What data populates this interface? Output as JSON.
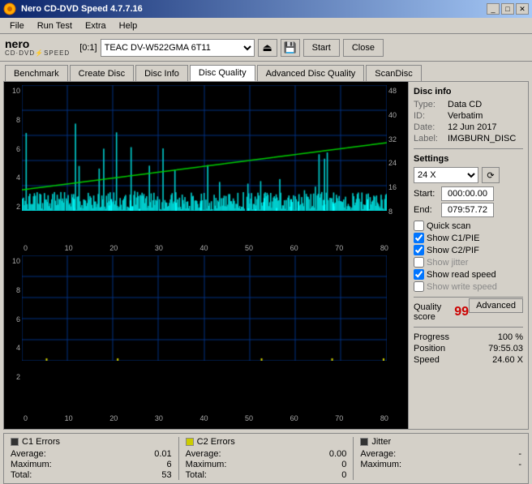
{
  "window": {
    "title": "Nero CD-DVD Speed 4.7.7.16",
    "title_buttons": [
      "_",
      "□",
      "✕"
    ]
  },
  "menu": {
    "items": [
      "File",
      "Run Test",
      "Extra",
      "Help"
    ]
  },
  "toolbar": {
    "drive_label": "[0:1]",
    "drive_value": "TEAC DV-W522GMA 6T11",
    "start_label": "Start",
    "close_label": "Close"
  },
  "tabs": [
    {
      "id": "benchmark",
      "label": "Benchmark"
    },
    {
      "id": "create-disc",
      "label": "Create Disc"
    },
    {
      "id": "disc-info",
      "label": "Disc Info"
    },
    {
      "id": "disc-quality",
      "label": "Disc Quality",
      "active": true
    },
    {
      "id": "advanced-disc-quality",
      "label": "Advanced Disc Quality"
    },
    {
      "id": "scandisc",
      "label": "ScanDisc"
    }
  ],
  "disc_info": {
    "section": "Disc info",
    "type_label": "Type:",
    "type_value": "Data CD",
    "id_label": "ID:",
    "id_value": "Verbatim",
    "date_label": "Date:",
    "date_value": "12 Jun 2017",
    "label_label": "Label:",
    "label_value": "IMGBURN_DISC"
  },
  "settings": {
    "section": "Settings",
    "speed_value": "24 X",
    "start_label": "Start:",
    "start_value": "000:00.00",
    "end_label": "End:",
    "end_value": "079:57.72",
    "quick_scan": "Quick scan",
    "show_c1": "Show C1/PIE",
    "show_c2": "Show C2/PIF",
    "show_jitter": "Show jitter",
    "show_read": "Show read speed",
    "show_write": "Show write speed",
    "advanced_label": "Advanced"
  },
  "quality": {
    "label": "Quality score",
    "score": "99"
  },
  "progress": {
    "progress_label": "Progress",
    "progress_value": "100 %",
    "position_label": "Position",
    "position_value": "79:55.03",
    "speed_label": "Speed",
    "speed_value": "24.60 X"
  },
  "stats": {
    "c1": {
      "label": "C1 Errors",
      "average_label": "Average:",
      "average_value": "0.01",
      "maximum_label": "Maximum:",
      "maximum_value": "6",
      "total_label": "Total:",
      "total_value": "53"
    },
    "c2": {
      "label": "C2 Errors",
      "average_label": "Average:",
      "average_value": "0.00",
      "maximum_label": "Maximum:",
      "maximum_value": "0",
      "total_label": "Total:",
      "total_value": "0"
    },
    "jitter": {
      "label": "Jitter",
      "average_label": "Average:",
      "average_value": "-",
      "maximum_label": "Maximum:",
      "maximum_value": "-",
      "total_label": "",
      "total_value": ""
    }
  },
  "chart": {
    "upper_y_right": [
      "48",
      "40",
      "32",
      "24",
      "16",
      "8"
    ],
    "upper_y_left": [
      "10",
      "8",
      "6",
      "4",
      "2"
    ],
    "lower_y_left": [
      "10",
      "8",
      "6",
      "4",
      "2"
    ],
    "x_labels": [
      "0",
      "10",
      "20",
      "30",
      "40",
      "50",
      "60",
      "70",
      "80"
    ]
  }
}
